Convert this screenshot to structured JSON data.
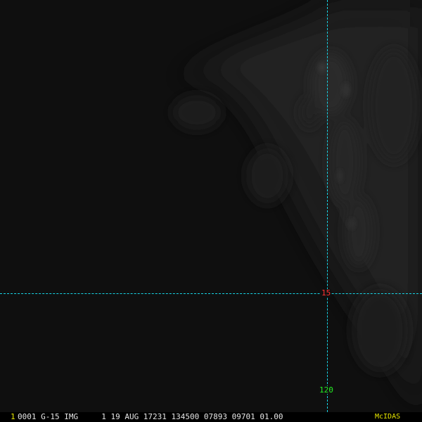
{
  "viewer": {
    "frame_number": "1",
    "header_text": "0001 G-15 IMG     1 19 AUG 17231 134500 07893 09701 01.00",
    "brand": "McIDAS"
  },
  "grid": {
    "latitude_label": "15",
    "longitude_label": "120"
  },
  "colors": {
    "background": "#101010",
    "grid_line": "#17d6e8",
    "latitude_label": "#ff3030",
    "longitude_label": "#22ee22",
    "frame_number": "#e8e800",
    "brand": "#e8e800",
    "header_text": "#e6e6e6"
  }
}
